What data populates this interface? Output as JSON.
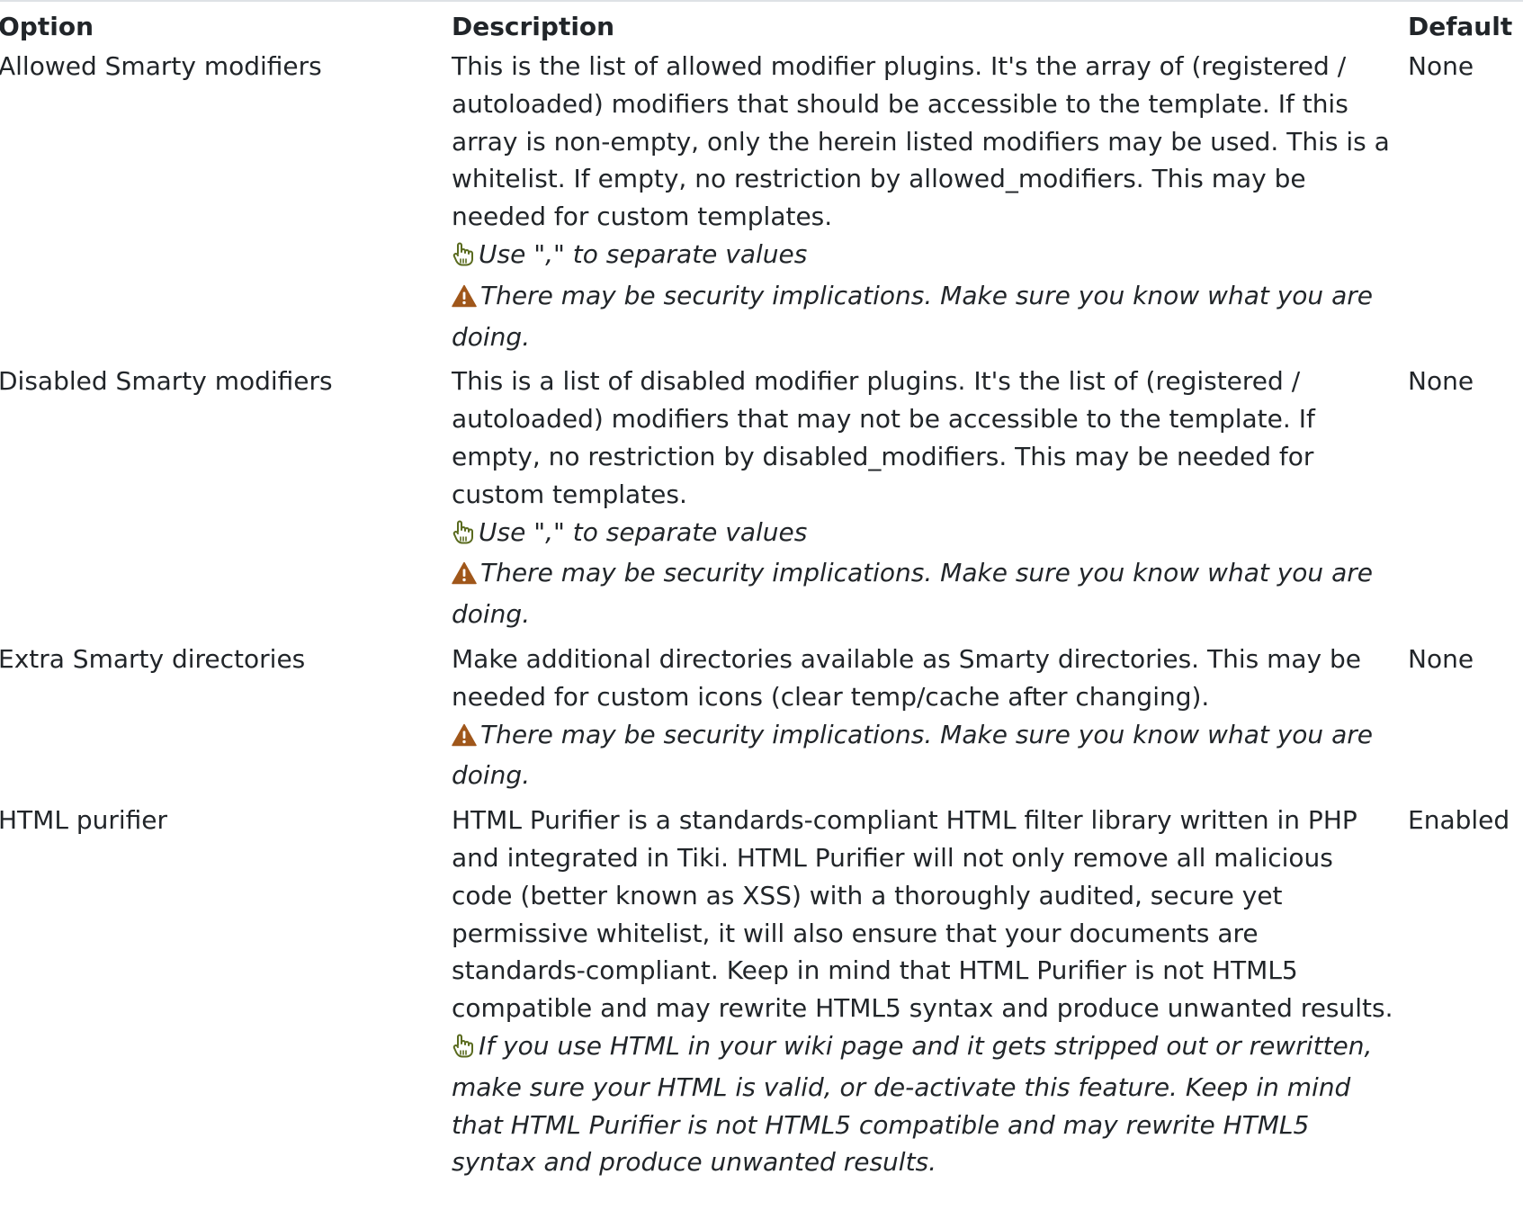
{
  "table": {
    "headers": {
      "option": "Option",
      "description": "Description",
      "default": "Default"
    },
    "rows": [
      {
        "option": "Allowed Smarty modifiers",
        "description": "This is the list of allowed modifier plugins. It's the array of (registered / autoloaded) modifiers that should be accessible to the template. If this array is non-empty, only the herein listed modifiers may be used. This is a whitelist. If empty, no restriction by allowed_modifiers. This may be needed for custom templates.",
        "tip": "Use \",\" to separate values",
        "warning": "There may be security implications. Make sure you know what you are doing.",
        "default": "None"
      },
      {
        "option": "Disabled Smarty modifiers",
        "description": "This is a list of disabled modifier plugins. It's the list of (registered / autoloaded) modifiers that may not be accessible to the template. If empty, no restriction by disabled_modifiers. This may be needed for custom templates.",
        "tip": "Use \",\" to separate values",
        "warning": "There may be security implications. Make sure you know what you are doing.",
        "default": "None"
      },
      {
        "option": "Extra Smarty directories",
        "description": "Make additional directories available as Smarty directories. This may be needed for custom icons (clear temp/cache after changing).",
        "warning": "There may be security implications. Make sure you know what you are doing.",
        "default": "None"
      },
      {
        "option": "HTML purifier",
        "description": "HTML Purifier is a standards-compliant HTML filter library written in PHP and integrated in Tiki. HTML Purifier will not only remove all malicious code (better known as XSS) with a thoroughly audited, secure yet permissive whitelist, it will also ensure that your documents are standards-compliant. Keep in mind that HTML Purifier is not HTML5 compatible and may rewrite HTML5 syntax and produce unwanted results.",
        "tip": "If you use HTML in your wiki page and it gets stripped out or rewritten, make sure your HTML is valid, or de-activate this feature. Keep in mind that HTML Purifier is not HTML5 compatible and may rewrite HTML5 syntax and produce unwanted results.",
        "default": "Enabled"
      }
    ]
  },
  "icons": {
    "tip": "pointing-hand-icon",
    "warning": "warning-triangle-icon",
    "tip_color": "#5a6b1f",
    "warning_color": "#a0571a"
  }
}
